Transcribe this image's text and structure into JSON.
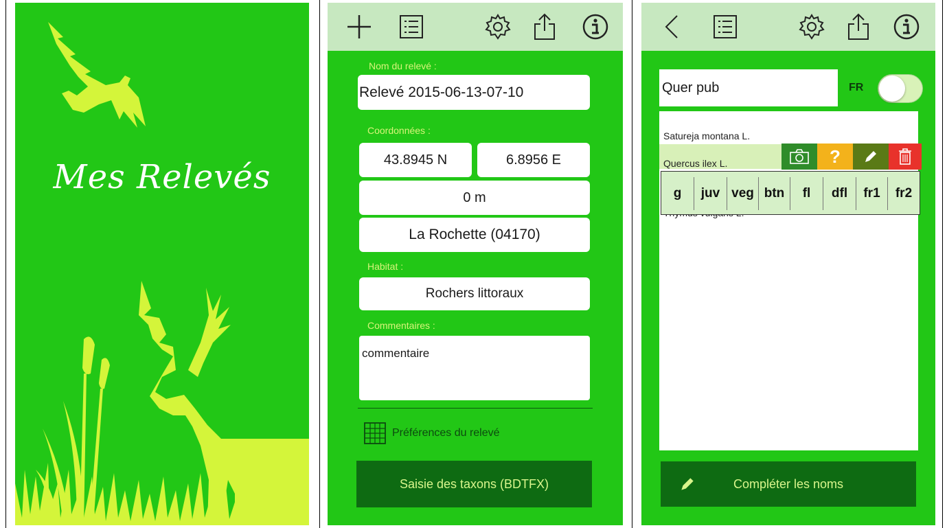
{
  "splash": {
    "title": "Mes Relevés"
  },
  "form": {
    "name_label": "Nom du relevé :",
    "name_value": "Relevé 2015-06-13-07-10",
    "coords_label": "Coordonnées :",
    "latitude": "43.8945 N",
    "longitude": "6.8956 E",
    "altitude": "0 m",
    "locality": "La Rochette (04170)",
    "habitat_label": "Habitat :",
    "habitat_value": "Rochers littoraux",
    "comment_label": "Commentaires :",
    "comment_value": "commentaire",
    "prefs_label": "Préférences du relevé",
    "taxa_button": "Saisie des taxons (BDTFX)"
  },
  "taxa": {
    "search_value": "Quer pub",
    "lang_label": "FR",
    "lang_toggle_on": false,
    "items": [
      "Satureja montana L.",
      "Quercus ilex L.",
      "Thymus vulgaris L."
    ],
    "actions": {
      "question_label": "?"
    },
    "tags": [
      "g",
      "juv",
      "veg",
      "btn",
      "fl",
      "dfl",
      "fr1",
      "fr2"
    ],
    "complete_button": "Compléter les noms"
  },
  "colors": {
    "background": "#22c716",
    "toolbar": "#c7e8c0",
    "label": "#d8f47a",
    "dark_button": "#0e6b12",
    "silhouette": "#d4f53a",
    "action_camera": "#2f8c2a",
    "action_question": "#f3b21b",
    "action_edit": "#5a7a16",
    "action_delete": "#e8322b"
  }
}
